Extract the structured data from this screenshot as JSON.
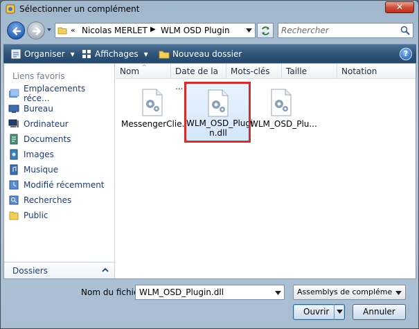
{
  "window": {
    "title": "Sélectionner un complément",
    "close_label": "✕"
  },
  "nav": {
    "address": {
      "overflow_glyph": "«",
      "crumbs": [
        "Nicolas MERLET",
        "WLM OSD Plugin"
      ],
      "separator": "▶"
    },
    "search": {
      "placeholder": "Rechercher"
    }
  },
  "toolbar": {
    "organize_label": "Organiser",
    "views_label": "Affichages",
    "new_folder_label": "Nouveau dossier",
    "help_label": "?"
  },
  "sidebar": {
    "favorites_title": "Liens favoris",
    "items": [
      {
        "label": "Emplacements réce...",
        "icon": "recent-places-icon"
      },
      {
        "label": "Bureau",
        "icon": "desktop-icon"
      },
      {
        "label": "Ordinateur",
        "icon": "computer-icon"
      },
      {
        "label": "Documents",
        "icon": "documents-icon"
      },
      {
        "label": "Images",
        "icon": "pictures-icon"
      },
      {
        "label": "Musique",
        "icon": "music-icon"
      },
      {
        "label": "Modifié récemment",
        "icon": "recently-changed-icon"
      },
      {
        "label": "Recherches",
        "icon": "searches-icon"
      },
      {
        "label": "Public",
        "icon": "public-folder-icon"
      }
    ],
    "folders_label": "Dossiers"
  },
  "files": {
    "columns": [
      "Nom",
      "Date de la ...",
      "Mots-clés",
      "Taille",
      "Notation"
    ],
    "items": [
      {
        "name": "MessengerClie...",
        "selected": false
      },
      {
        "name": "WLM_OSD_Plugin.dll",
        "name_line1": "WLM_OSD_Plugi",
        "name_line2": "n.dll",
        "selected": true
      },
      {
        "name": "WLM_OSD_Plu...",
        "selected": false
      }
    ]
  },
  "footer": {
    "filename_label": "Nom du fichier :",
    "filename_value": "WLM_OSD_Plugin.dll",
    "filter_value": "Assemblys de complément (*.d",
    "open_label": "Ouvrir",
    "cancel_label": "Annuler"
  },
  "colors": {
    "toolbar": "#2f5478",
    "selection_outline": "#d42d2d",
    "link_text": "#1e3b6e"
  }
}
